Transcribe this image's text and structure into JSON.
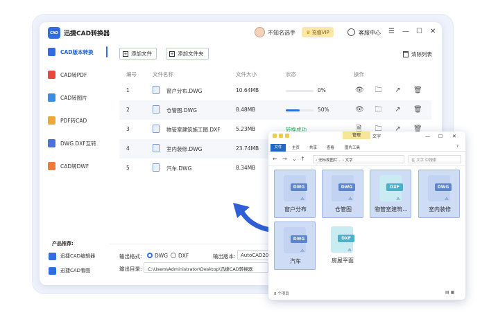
{
  "app": {
    "logo_text": "CAD",
    "title": "迅捷CAD转换器",
    "user_name": "不知名选手",
    "vip_label": "充值VIP",
    "service_label": "客服中心",
    "window_controls": [
      "☰",
      "—",
      "☐",
      "✕"
    ]
  },
  "sidebar": {
    "items": [
      {
        "label": "CAD版本转换",
        "color": "#2f6de1"
      },
      {
        "label": "CAD转PDF",
        "color": "#e8473c"
      },
      {
        "label": "CAD转图片",
        "color": "#3a8de0"
      },
      {
        "label": "PDF转CAD",
        "color": "#f0a73a"
      },
      {
        "label": "DWG DXF互转",
        "color": "#4c72d8"
      },
      {
        "label": "CAD转DWF",
        "color": "#f07a3a"
      }
    ],
    "recommend_title": "产品推荐:",
    "recommend": [
      "迅捷CAD编辑器",
      "迅捷CAD看图"
    ]
  },
  "toolbar": {
    "add_file": "添加文件",
    "add_folder": "添加文件夹",
    "clear_list": "清除列表"
  },
  "table": {
    "headers": [
      "编号",
      "文件名称",
      "文件大小",
      "状态",
      "操作"
    ],
    "rows": [
      {
        "no": "1",
        "name": "窗户分布.DWG",
        "size": "10.64MB",
        "status": "0%",
        "progress": 0
      },
      {
        "no": "2",
        "name": "仓管图.DWG",
        "size": "8.48MB",
        "status": "50%",
        "progress": 50
      },
      {
        "no": "3",
        "name": "物管室建筑施工图.DXF",
        "size": "5.23MB",
        "status": "转换成功",
        "progress": 100
      },
      {
        "no": "4",
        "name": "室内装修.DWG",
        "size": "23.74MB",
        "status": "",
        "progress": null
      },
      {
        "no": "5",
        "name": "汽车.DWG",
        "size": "8.34MB",
        "status": "",
        "progress": null
      }
    ]
  },
  "bottom": {
    "format_label": "输出格式:",
    "format_dwg": "DWG",
    "format_dxf": "DXF",
    "version_label": "输出版本:",
    "version_value": "AutoCAD2000",
    "dir_label": "输出目录:",
    "dir_value": "C:\\Users\\Administrator\\Desktop\\迅捷CAD转换器"
  },
  "explorer": {
    "manage_tab": "管理",
    "title": "文字",
    "window_controls": [
      "—",
      "☐",
      "✕"
    ],
    "ribbon": [
      "文件",
      "主页",
      "共享",
      "查看",
      "图片工具"
    ],
    "address": "‹ 无标视图片… › 文字",
    "search_placeholder": "在 文字 中搜索",
    "files": [
      {
        "type": "DWG",
        "name": "窗户分布",
        "selected": true
      },
      {
        "type": "DWG",
        "name": "仓管图",
        "selected": true
      },
      {
        "type": "DXF",
        "name": "物管室建筑...",
        "selected": true
      },
      {
        "type": "DWG",
        "name": "室内装修",
        "selected": true
      },
      {
        "type": "DWG",
        "name": "汽车",
        "selected": true
      },
      {
        "type": "DXF",
        "name": "房屋平面",
        "selected": false
      }
    ],
    "status": "8 个项目"
  }
}
